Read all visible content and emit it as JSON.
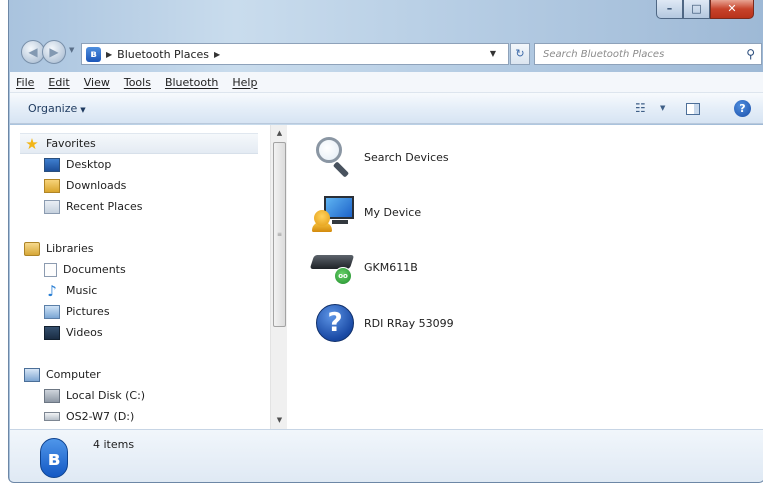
{
  "window": {
    "controls": {
      "minimize": "–",
      "maximize": "□",
      "close": "✕"
    }
  },
  "address_bar": {
    "breadcrumb": "Bluetooth Places",
    "search_placeholder": "Search Bluetooth Places"
  },
  "menu": [
    "File",
    "Edit",
    "View",
    "Tools",
    "Bluetooth",
    "Help"
  ],
  "command_bar": {
    "organize_label": "Organize"
  },
  "nav_pane": {
    "favorites": {
      "label": "Favorites",
      "items": [
        "Desktop",
        "Downloads",
        "Recent Places"
      ]
    },
    "libraries": {
      "label": "Libraries",
      "items": [
        "Documents",
        "Music",
        "Pictures",
        "Videos"
      ]
    },
    "computer": {
      "label": "Computer",
      "items": [
        "Local Disk (C:)",
        "OS2-W7 (D:)"
      ]
    }
  },
  "devices": [
    {
      "label": "Search Devices",
      "icon": "magnifier-icon"
    },
    {
      "label": "My Device",
      "icon": "computer-user-icon"
    },
    {
      "label": "GKM611B",
      "icon": "keyboard-device-icon"
    },
    {
      "label": "RDI RRay 53099",
      "icon": "unknown-device-icon"
    }
  ],
  "details_pane": {
    "item_count": "4 items"
  },
  "colors": {
    "accent": "#1358c4",
    "window_frame": "#b6cde4",
    "close_button": "#c7432b"
  }
}
